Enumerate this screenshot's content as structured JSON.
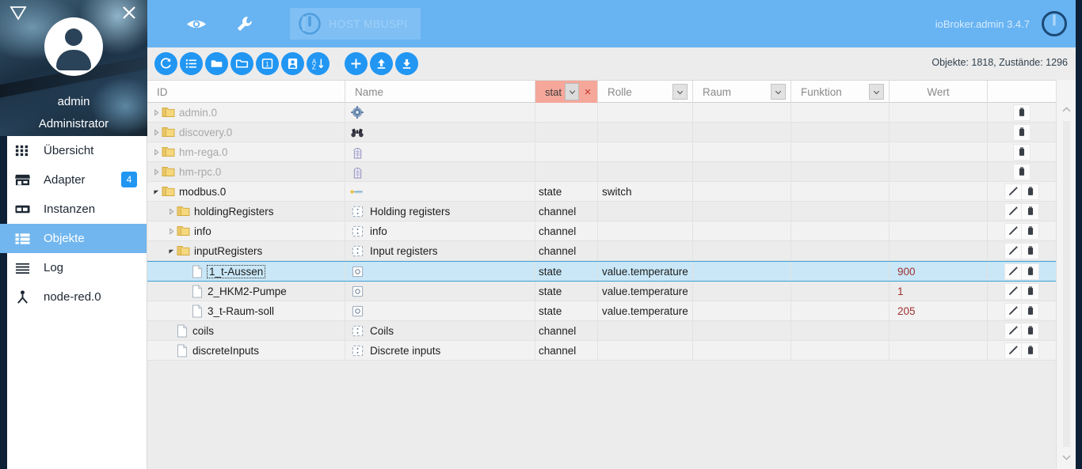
{
  "sidebar": {
    "logo_icon": "iobroker-triangle-logo",
    "close_icon": "close-icon",
    "avatar_icon": "user-avatar",
    "user_name": "admin",
    "user_role": "Administrator",
    "items": [
      {
        "label": "Übersicht",
        "icon": "grid-icon",
        "active": false,
        "badge": ""
      },
      {
        "label": "Adapter",
        "icon": "store-icon",
        "active": false,
        "badge": "4"
      },
      {
        "label": "Instanzen",
        "icon": "instances-icon",
        "active": false,
        "badge": ""
      },
      {
        "label": "Objekte",
        "icon": "list-alt-icon",
        "active": true,
        "badge": ""
      },
      {
        "label": "Log",
        "icon": "lines-icon",
        "active": false,
        "badge": ""
      },
      {
        "label": "node-red.0",
        "icon": "node-red-icon",
        "active": false,
        "badge": ""
      }
    ]
  },
  "header": {
    "eye_icon": "eye-icon",
    "wrench_icon": "wrench-icon",
    "host_label": "HOST MBUSPI",
    "host_icon": "power-info-icon",
    "version": "ioBroker.admin 3.4.7",
    "power_icon": "power-icon",
    "accent_color": "#68b3f2"
  },
  "toolbar": {
    "buttons": [
      {
        "name": "refresh-button",
        "icon": "refresh-icon"
      },
      {
        "name": "expand-all-button",
        "icon": "list-icon"
      },
      {
        "name": "collapse-all-button",
        "icon": "folder-filled-icon"
      },
      {
        "name": "expand-folders-button",
        "icon": "folder-outline-icon"
      },
      {
        "name": "one-level-button",
        "icon": "one-badge-icon"
      },
      {
        "name": "custom-button",
        "icon": "id-card-icon"
      },
      {
        "name": "sort-az-button",
        "icon": "az-sort-icon"
      },
      {
        "name": "add-object-button",
        "icon": "plus-icon"
      },
      {
        "name": "upload-button",
        "icon": "upload-icon"
      },
      {
        "name": "download-button",
        "icon": "download-icon"
      }
    ],
    "object_count": "Objekte: 1818, Zustände: 1296",
    "button_color": "#2196f3"
  },
  "table": {
    "columns": {
      "id": "ID",
      "name": "Name",
      "type_filter_value": "stat",
      "type_filter_clear": "×",
      "role": "Rolle",
      "room": "Raum",
      "function": "Funktion",
      "value": "Wert"
    },
    "filter_color": "#f5a79a",
    "rows": [
      {
        "id": "admin.0",
        "indent": 0,
        "twisty": "collapsed",
        "node": "folder",
        "name": "",
        "name_icon": "gear-icon",
        "type": "",
        "role": "",
        "room": "",
        "function": "",
        "value": "",
        "dim": true,
        "selected": false,
        "actions": [
          "delete"
        ]
      },
      {
        "id": "discovery.0",
        "indent": 0,
        "twisty": "collapsed",
        "node": "folder",
        "name": "",
        "name_icon": "binoculars-icon",
        "type": "",
        "role": "",
        "room": "",
        "function": "",
        "value": "",
        "dim": true,
        "selected": false,
        "actions": [
          "delete"
        ]
      },
      {
        "id": "hm-rega.0",
        "indent": 0,
        "twisty": "collapsed",
        "node": "folder",
        "name": "",
        "name_icon": "building-icon",
        "type": "",
        "role": "",
        "room": "",
        "function": "",
        "value": "",
        "dim": true,
        "selected": false,
        "actions": [
          "delete"
        ]
      },
      {
        "id": "hm-rpc.0",
        "indent": 0,
        "twisty": "collapsed",
        "node": "folder",
        "name": "",
        "name_icon": "building-icon",
        "type": "",
        "role": "",
        "room": "",
        "function": "",
        "value": "",
        "dim": true,
        "selected": false,
        "actions": [
          "delete"
        ]
      },
      {
        "id": "modbus.0",
        "indent": 0,
        "twisty": "expanded",
        "node": "folder",
        "name": "",
        "name_icon": "modbus-icon",
        "type": "state",
        "role": "switch",
        "room": "",
        "function": "",
        "value": "",
        "dim": false,
        "selected": false,
        "actions": [
          "edit",
          "delete"
        ]
      },
      {
        "id": "holdingRegisters",
        "indent": 1,
        "twisty": "collapsed",
        "node": "folder",
        "name": "Holding registers",
        "name_icon": "channel-icon",
        "type": "channel",
        "role": "",
        "room": "",
        "function": "",
        "value": "",
        "dim": false,
        "selected": false,
        "actions": [
          "edit",
          "delete"
        ]
      },
      {
        "id": "info",
        "indent": 1,
        "twisty": "collapsed",
        "node": "folder",
        "name": "info",
        "name_icon": "channel-icon",
        "type": "channel",
        "role": "",
        "room": "",
        "function": "",
        "value": "",
        "dim": false,
        "selected": false,
        "actions": [
          "edit",
          "delete"
        ]
      },
      {
        "id": "inputRegisters",
        "indent": 1,
        "twisty": "expanded",
        "node": "folder",
        "name": "Input registers",
        "name_icon": "channel-icon",
        "type": "channel",
        "role": "",
        "room": "",
        "function": "",
        "value": "",
        "dim": false,
        "selected": false,
        "actions": [
          "edit",
          "delete"
        ]
      },
      {
        "id": "1_t-Aussen",
        "indent": 2,
        "twisty": "none",
        "node": "file",
        "name": "",
        "name_icon": "state-icon",
        "type": "state",
        "role": "value.temperature",
        "room": "",
        "function": "",
        "value": "900",
        "dim": false,
        "selected": true,
        "actions": [
          "edit",
          "delete"
        ]
      },
      {
        "id": "2_HKM2-Pumpe",
        "indent": 2,
        "twisty": "none",
        "node": "file",
        "name": "",
        "name_icon": "state-icon",
        "type": "state",
        "role": "value.temperature",
        "room": "",
        "function": "",
        "value": "1",
        "dim": false,
        "selected": false,
        "actions": [
          "edit",
          "delete"
        ]
      },
      {
        "id": "3_t-Raum-soll",
        "indent": 2,
        "twisty": "none",
        "node": "file",
        "name": "",
        "name_icon": "state-icon",
        "type": "state",
        "role": "value.temperature",
        "room": "",
        "function": "",
        "value": "205",
        "dim": false,
        "selected": false,
        "actions": [
          "edit",
          "delete"
        ]
      },
      {
        "id": "coils",
        "indent": 1,
        "twisty": "none",
        "node": "file",
        "name": "Coils",
        "name_icon": "channel-icon",
        "type": "channel",
        "role": "",
        "room": "",
        "function": "",
        "value": "",
        "dim": false,
        "selected": false,
        "actions": [
          "edit",
          "delete"
        ]
      },
      {
        "id": "discreteInputs",
        "indent": 1,
        "twisty": "none",
        "node": "file",
        "name": "Discrete inputs",
        "name_icon": "channel-icon",
        "type": "channel",
        "role": "",
        "room": "",
        "function": "",
        "value": "",
        "dim": false,
        "selected": false,
        "actions": [
          "edit",
          "delete"
        ]
      }
    ]
  },
  "scrollbar": {
    "up_icon": "chevron-up-icon",
    "down_icon": "chevron-down-icon"
  }
}
